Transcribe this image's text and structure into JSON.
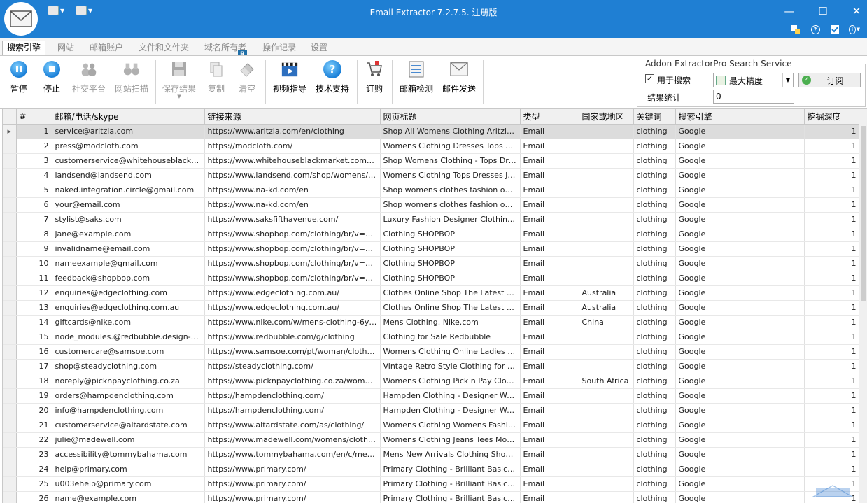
{
  "window": {
    "title": "Email Extractor 7.2.7.5. 注册版",
    "minimize": "—",
    "maximize": "☐",
    "close": "✕"
  },
  "tabs": [
    {
      "label": "搜索引擎",
      "active": true
    },
    {
      "label": "网站"
    },
    {
      "label": "邮箱账户"
    },
    {
      "label": "文件和文件夹"
    },
    {
      "label": "域名所有者"
    },
    {
      "label": "操作记录"
    },
    {
      "label": "设置"
    }
  ],
  "r_badge": "R",
  "ribbon": {
    "pause": "暂停",
    "stop": "停止",
    "social": "社交平台",
    "site_scan": "网站扫描",
    "save_results": "保存结果",
    "copy": "复制",
    "clear": "清空",
    "video_guide": "视频指导",
    "tech_support": "技术支持",
    "subscribe_order": "订购",
    "email_check": "邮箱检测",
    "email_send": "邮件发送"
  },
  "addon": {
    "group_title": "Addon ExtractorPro Search Service",
    "use_for_search": "用于搜索",
    "use_for_search_checked": true,
    "accuracy": "最大精度",
    "subscribe": "订阅",
    "stats_label": "结果统计",
    "stats_value": "0"
  },
  "table": {
    "columns": [
      "#",
      "邮箱/电话/skype",
      "链接来源",
      "网页标题",
      "类型",
      "国家或地区",
      "关键词",
      "搜索引擎",
      "挖掘深度"
    ],
    "rows": [
      [
        "1",
        "service@aritzia.com",
        "https://www.aritzia.com/en/clothing",
        "Shop All Womens Clothing  Aritzia CA",
        "Email",
        "",
        "clothing",
        "Google",
        "1"
      ],
      [
        "2",
        "press@modcloth.com",
        "https://modcloth.com/",
        "Womens Clothing Dresses Tops Skirts...",
        "Email",
        "",
        "clothing",
        "Google",
        "1"
      ],
      [
        "3",
        "customerservice@whitehouseblackmarke...",
        "https://www.whitehouseblackmarket.com/store...",
        "Shop Womens Clothing - Tops Dresse...",
        "Email",
        "",
        "clothing",
        "Google",
        "1"
      ],
      [
        "4",
        "landsend@landsend.com",
        "https://www.landsend.com/shop/womens/S-xe...",
        "Womens Clothing Tops Dresses Jean...",
        "Email",
        "",
        "clothing",
        "Google",
        "1"
      ],
      [
        "5",
        "naked.integration.circle@gmail.com",
        "https://www.na-kd.com/en",
        "Shop womens clothes  fashion online ...",
        "Email",
        "",
        "clothing",
        "Google",
        "1"
      ],
      [
        "6",
        "your@email.com",
        "https://www.na-kd.com/en",
        "Shop womens clothes  fashion online ...",
        "Email",
        "",
        "clothing",
        "Google",
        "1"
      ],
      [
        "7",
        "stylist@saks.com",
        "https://www.saksfifthavenue.com/",
        "Luxury Fashion  Designer Clothing Sh...",
        "Email",
        "",
        "clothing",
        "Google",
        "1"
      ],
      [
        "8",
        "jane@example.com",
        "https://www.shopbop.com/clothing/br/v=1/132...",
        "Clothing  SHOPBOP",
        "Email",
        "",
        "clothing",
        "Google",
        "1"
      ],
      [
        "9",
        "invalidname@email.com",
        "https://www.shopbop.com/clothing/br/v=1/132...",
        "Clothing  SHOPBOP",
        "Email",
        "",
        "clothing",
        "Google",
        "1"
      ],
      [
        "10",
        "nameexample@gmail.com",
        "https://www.shopbop.com/clothing/br/v=1/132...",
        "Clothing  SHOPBOP",
        "Email",
        "",
        "clothing",
        "Google",
        "1"
      ],
      [
        "11",
        "feedback@shopbop.com",
        "https://www.shopbop.com/clothing/br/v=1/132...",
        "Clothing  SHOPBOP",
        "Email",
        "",
        "clothing",
        "Google",
        "1"
      ],
      [
        "12",
        "enquiries@edgeclothing.com",
        "https://www.edgeclothing.com.au/",
        "Clothes Online  Shop The Latest Fash...",
        "Email",
        "Australia",
        "clothing",
        "Google",
        "1"
      ],
      [
        "13",
        "enquiries@edgeclothing.com.au",
        "https://www.edgeclothing.com.au/",
        "Clothes Online  Shop The Latest Fash...",
        "Email",
        "Australia",
        "clothing",
        "Google",
        "1"
      ],
      [
        "14",
        "giftcards@nike.com",
        "https://www.nike.com/w/mens-clothing-6ymx6z...",
        "Mens Clothing. Nike.com",
        "Email",
        "China",
        "clothing",
        "Google",
        "1"
      ],
      [
        "15",
        "node_modules.@redbubble.design-syste...",
        "https://www.redbubble.com/g/clothing",
        "Clothing for Sale  Redbubble",
        "Email",
        "",
        "clothing",
        "Google",
        "1"
      ],
      [
        "16",
        "customercare@samsoe.com",
        "https://www.samsoe.com/pt/woman/clothing/",
        "Womens Clothing Online  Ladies Cloth...",
        "Email",
        "",
        "clothing",
        "Google",
        "1"
      ],
      [
        "17",
        "shop@steadyclothing.com",
        "https://steadyclothing.com/",
        "Vintage  Retro Style Clothing for Men...",
        "Email",
        "",
        "clothing",
        "Google",
        "1"
      ],
      [
        "18",
        "noreply@picknpayclothing.co.za",
        "https://www.picknpayclothing.co.za/womens",
        "Womens Clothing  Pick n Pay Clothing",
        "Email",
        "South Africa",
        "clothing",
        "Google",
        "1"
      ],
      [
        "19",
        "orders@hampdenclothing.com",
        "https://hampdenclothing.com/",
        "Hampden Clothing - Designer Women...",
        "Email",
        "",
        "clothing",
        "Google",
        "1"
      ],
      [
        "20",
        "info@hampdenclothing.com",
        "https://hampdenclothing.com/",
        "Hampden Clothing - Designer Women...",
        "Email",
        "",
        "clothing",
        "Google",
        "1"
      ],
      [
        "21",
        "customerservice@altardstate.com",
        "https://www.altardstate.com/as/clothing/",
        "Womens Clothing  Womens Fashion  ...",
        "Email",
        "",
        "clothing",
        "Google",
        "1"
      ],
      [
        "22",
        "julie@madewell.com",
        "https://www.madewell.com/womens/clothing",
        "Womens Clothing Jeans Tees  More  ...",
        "Email",
        "",
        "clothing",
        "Google",
        "1"
      ],
      [
        "23",
        "accessibility@tommybahama.com",
        "https://www.tommybahama.com/en/c/men-men...",
        "Mens New Arrivals Clothing Shoes  M...",
        "Email",
        "",
        "clothing",
        "Google",
        "1"
      ],
      [
        "24",
        "help@primary.com",
        "https://www.primary.com/",
        "Primary Clothing - Brilliant Basics for B...",
        "Email",
        "",
        "clothing",
        "Google",
        "1"
      ],
      [
        "25",
        "u003ehelp@primary.com",
        "https://www.primary.com/",
        "Primary Clothing - Brilliant Basics for B...",
        "Email",
        "",
        "clothing",
        "Google",
        "1"
      ],
      [
        "26",
        "name@example.com",
        "https://www.primary.com/",
        "Primary Clothing - Brilliant Basics for B...",
        "Email",
        "",
        "clothing",
        "Google",
        "1"
      ]
    ]
  }
}
